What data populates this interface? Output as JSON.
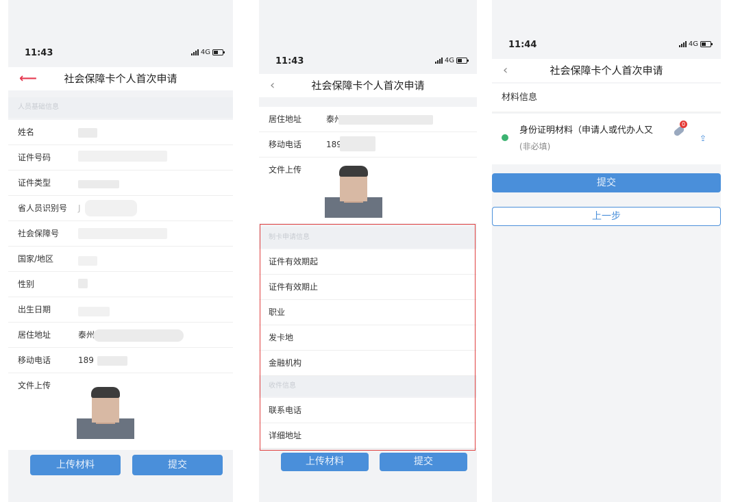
{
  "screen1": {
    "time": "11:43",
    "network": "4G",
    "title": "社会保障卡个人首次申请",
    "section_label": "人员基础信息",
    "fields": [
      {
        "label": "姓名",
        "value": ""
      },
      {
        "label": "证件号码",
        "value": ""
      },
      {
        "label": "证件类型",
        "value": ""
      },
      {
        "label": "省人员识别号",
        "value": "J"
      },
      {
        "label": "社会保障号",
        "value": ""
      },
      {
        "label": "国家/地区",
        "value": ""
      },
      {
        "label": "性别",
        "value": ""
      },
      {
        "label": "出生日期",
        "value": ""
      },
      {
        "label": "居住地址",
        "value": "泰州"
      },
      {
        "label": "移动电话",
        "value": "189"
      }
    ],
    "upload_label": "文件上传",
    "btn_upload": "上传材料",
    "btn_submit": "提交"
  },
  "screen2": {
    "time": "11:43",
    "network": "4G",
    "title": "社会保障卡个人首次申请",
    "fields": [
      {
        "label": "居住地址",
        "value": "泰州"
      },
      {
        "label": "移动电话",
        "value": "189"
      }
    ],
    "upload_label": "文件上传",
    "section_card": "制卡申请信息",
    "card_fields": [
      "证件有效期起",
      "证件有效期止",
      "职业",
      "发卡地",
      "金融机构"
    ],
    "section_mail": "收件信息",
    "mail_fields": [
      "联系电话",
      "详细地址"
    ],
    "btn_upload": "上传材料",
    "btn_submit": "提交"
  },
  "screen3": {
    "time": "11:44",
    "network": "4G",
    "title": "社会保障卡个人首次申请",
    "section_title": "材料信息",
    "material_name": "身份证明材料（申请人或代办人又",
    "material_note": "(非必填)",
    "badge_count": "0",
    "btn_submit": "提交",
    "btn_prev": "上一步"
  },
  "colors": {
    "primary": "#4a8fda",
    "highlight_border": "#e04040",
    "back_accent": "#e53950",
    "check": "#3cb371"
  }
}
